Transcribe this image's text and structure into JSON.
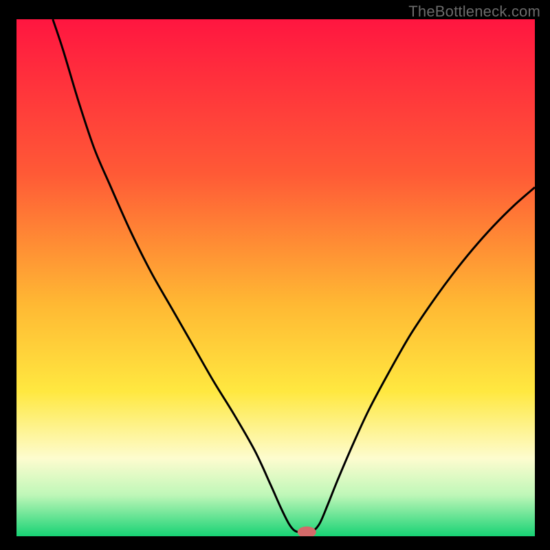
{
  "watermark": "TheBottleneck.com",
  "chart_data": {
    "type": "line",
    "title": "",
    "xlabel": "",
    "ylabel": "",
    "x_range": [
      0,
      100
    ],
    "y_range": [
      0,
      100
    ],
    "gradient_stops": [
      {
        "offset": 0,
        "color": "#ff1640"
      },
      {
        "offset": 30,
        "color": "#ff5a36"
      },
      {
        "offset": 55,
        "color": "#ffb833"
      },
      {
        "offset": 72,
        "color": "#ffe840"
      },
      {
        "offset": 85,
        "color": "#fdfccf"
      },
      {
        "offset": 92,
        "color": "#bff7b8"
      },
      {
        "offset": 100,
        "color": "#17d274"
      }
    ],
    "curve_points": [
      {
        "x": 7.0,
        "y": 100.0
      },
      {
        "x": 9.0,
        "y": 94.0
      },
      {
        "x": 12.0,
        "y": 84.0
      },
      {
        "x": 15.0,
        "y": 75.0
      },
      {
        "x": 18.0,
        "y": 68.0
      },
      {
        "x": 22.0,
        "y": 59.0
      },
      {
        "x": 26.0,
        "y": 51.0
      },
      {
        "x": 30.0,
        "y": 44.0
      },
      {
        "x": 34.0,
        "y": 37.0
      },
      {
        "x": 38.0,
        "y": 30.0
      },
      {
        "x": 42.0,
        "y": 23.5
      },
      {
        "x": 46.0,
        "y": 16.5
      },
      {
        "x": 49.0,
        "y": 10.0
      },
      {
        "x": 51.0,
        "y": 5.5
      },
      {
        "x": 52.5,
        "y": 2.5
      },
      {
        "x": 53.5,
        "y": 1.2
      },
      {
        "x": 54.5,
        "y": 0.8
      },
      {
        "x": 56.0,
        "y": 0.8
      },
      {
        "x": 57.2,
        "y": 1.0
      },
      {
        "x": 58.5,
        "y": 2.5
      },
      {
        "x": 60.0,
        "y": 6.0
      },
      {
        "x": 62.0,
        "y": 11.0
      },
      {
        "x": 65.0,
        "y": 18.0
      },
      {
        "x": 68.0,
        "y": 24.5
      },
      {
        "x": 72.0,
        "y": 32.0
      },
      {
        "x": 76.0,
        "y": 39.0
      },
      {
        "x": 80.0,
        "y": 45.0
      },
      {
        "x": 84.0,
        "y": 50.5
      },
      {
        "x": 88.0,
        "y": 55.5
      },
      {
        "x": 92.0,
        "y": 60.0
      },
      {
        "x": 96.0,
        "y": 64.0
      },
      {
        "x": 100.0,
        "y": 67.5
      }
    ],
    "marker": {
      "x": 56.0,
      "y": 0.8,
      "rx": 1.8,
      "ry": 1.1,
      "color": "#d46a6a"
    }
  }
}
